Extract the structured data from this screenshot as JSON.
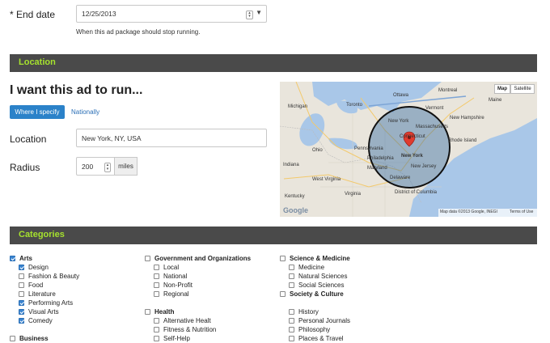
{
  "end_date": {
    "label": "* End date",
    "value": "12/25/2013",
    "help": "When this ad package should stop running."
  },
  "location_section": {
    "header": "Location",
    "heading": "I want this ad to run...",
    "tab_specify": "Where I specify",
    "tab_nationally": "Nationally",
    "location_label": "Location",
    "location_value": "New York, NY, USA",
    "radius_label": "Radius",
    "radius_value": "200",
    "radius_unit": "miles"
  },
  "map": {
    "btn_map": "Map",
    "btn_satellite": "Satellite",
    "attribution": "Map data ©2013 Google, INEGI",
    "terms": "Terms of Use",
    "logo": "Google",
    "places": [
      "Michigan",
      "Toronto",
      "Ottawa",
      "Montreal",
      "Maine",
      "Vermont",
      "New Hampshire",
      "New York",
      "Massachusetts",
      "Connecticut",
      "Rhode Island",
      "Ohio",
      "Pennsylvania",
      "Philadelphia",
      "New Jersey",
      "Indiana",
      "Maryland",
      "Delaware",
      "West Virginia",
      "Virginia",
      "Kentucky",
      "District of Columbia"
    ],
    "marker_label": "New York"
  },
  "categories_section": {
    "header": "Categories",
    "columns": [
      [
        {
          "label": "Arts",
          "head": true,
          "checked": true
        },
        {
          "label": "Design",
          "checked": true
        },
        {
          "label": "Fashion & Beauty",
          "checked": false
        },
        {
          "label": "Food",
          "checked": false
        },
        {
          "label": "Literature",
          "checked": false
        },
        {
          "label": "Performing Arts",
          "checked": true
        },
        {
          "label": "Visual Arts",
          "checked": true
        },
        {
          "label": "Comedy",
          "checked": true
        },
        {
          "label": "Business",
          "head": true,
          "checked": false
        }
      ],
      [
        {
          "label": "Government and Organizations",
          "head": true,
          "checked": false
        },
        {
          "label": "Local",
          "checked": false
        },
        {
          "label": "National",
          "checked": false
        },
        {
          "label": "Non-Profit",
          "checked": false
        },
        {
          "label": "Regional",
          "checked": false
        },
        {
          "label": "Health",
          "head": true,
          "checked": false
        },
        {
          "label": "Alternative Healt",
          "checked": false
        },
        {
          "label": "Fitness & Nutrition",
          "checked": false
        },
        {
          "label": "Self-Help",
          "checked": false
        }
      ],
      [
        {
          "label": "Science & Medicine",
          "head": true,
          "checked": false
        },
        {
          "label": "Medicine",
          "checked": false
        },
        {
          "label": "Natural Sciences",
          "checked": false
        },
        {
          "label": "Social Sciences",
          "checked": false
        },
        {
          "label": "Society & Culture",
          "head": true,
          "checked": false
        },
        {
          "label": "History",
          "checked": false
        },
        {
          "label": "Personal Journals",
          "checked": false
        },
        {
          "label": "Philosophy",
          "checked": false
        },
        {
          "label": "Places & Travel",
          "checked": false
        }
      ]
    ]
  },
  "colors": {
    "accent": "#a6e22e",
    "section_bar": "#4a4a4a",
    "primary_button": "#2b82c9",
    "link": "#2b6fb6"
  }
}
